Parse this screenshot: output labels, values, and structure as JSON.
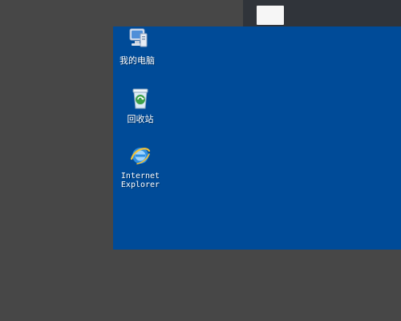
{
  "desktop": {
    "icons": [
      {
        "label": "我的电脑",
        "icon": "my-computer-icon"
      },
      {
        "label": "回收站",
        "icon": "recycle-bin-icon"
      },
      {
        "label": "Internet\nExplorer",
        "icon": "internet-explorer-icon"
      }
    ]
  },
  "colors": {
    "outer_background": "#474747",
    "desktop_background": "#004b98",
    "top_strip": "#30343a",
    "top_strip_block": "#f6f6f6"
  }
}
